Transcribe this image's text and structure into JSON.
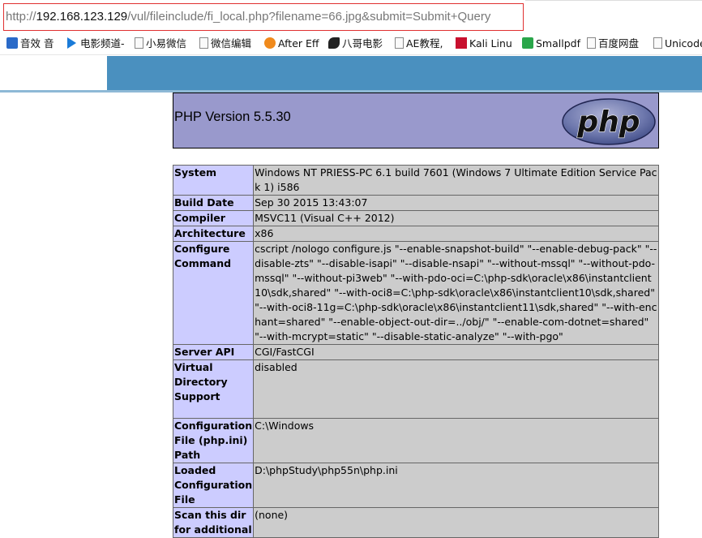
{
  "browser": {
    "url_prefix": "http://",
    "url_host": "192.168.123.129",
    "url_path": "/vul/fileinclude/fi_local.php?filename=66.jpg&submit=Submit+Query"
  },
  "bookmarks": [
    {
      "label": "音效 音",
      "icon": "music-icon"
    },
    {
      "label": "电影频道-",
      "icon": "play-icon"
    },
    {
      "label": "小易微信",
      "icon": "doc-icon"
    },
    {
      "label": "微信编辑",
      "icon": "doc-icon"
    },
    {
      "label": "After Eff",
      "icon": "orange-icon"
    },
    {
      "label": "八哥电影",
      "icon": "bird-icon"
    },
    {
      "label": "AE教程,",
      "icon": "doc-icon"
    },
    {
      "label": "Kali Linu",
      "icon": "kali-icon"
    },
    {
      "label": "Smallpdf",
      "icon": "smallpdf-icon"
    },
    {
      "label": "百度网盘",
      "icon": "doc-icon"
    },
    {
      "label": "Unicode",
      "icon": "doc-icon"
    }
  ],
  "phpinfo": {
    "version": "PHP Version 5.5.30",
    "logo_text": "php",
    "rows": [
      {
        "key": "System",
        "value": "Windows NT PRIESS-PC 6.1 build 7601 (Windows 7 Ultimate Edition Service Pack 1) i586"
      },
      {
        "key": "Build Date",
        "value": "Sep 30 2015 13:43:07"
      },
      {
        "key": "Compiler",
        "value": "MSVC11 (Visual C++ 2012)"
      },
      {
        "key": "Architecture",
        "value": "x86"
      },
      {
        "key": "Configure Command",
        "value": "cscript /nologo configure.js \"--enable-snapshot-build\" \"--enable-debug-pack\" \"--disable-zts\" \"--disable-isapi\" \"--disable-nsapi\" \"--without-mssql\" \"--without-pdo-mssql\" \"--without-pi3web\" \"--with-pdo-oci=C:\\php-sdk\\oracle\\x86\\instantclient10\\sdk,shared\" \"--with-oci8=C:\\php-sdk\\oracle\\x86\\instantclient10\\sdk,shared\" \"--with-oci8-11g=C:\\php-sdk\\oracle\\x86\\instantclient11\\sdk,shared\" \"--with-enchant=shared\" \"--enable-object-out-dir=../obj/\" \"--enable-com-dotnet=shared\" \"--with-mcrypt=static\" \"--disable-static-analyze\" \"--with-pgo\""
      },
      {
        "key": "Server API",
        "value": "CGI/FastCGI"
      },
      {
        "key": "Virtual Directory Support",
        "value": "disabled"
      },
      {
        "key": "Configuration File (php.ini) Path",
        "value": "C:\\Windows"
      },
      {
        "key": "Loaded Configuration File",
        "value": "D:\\phpStudy\\php55n\\php.ini"
      },
      {
        "key": "Scan this dir for additional",
        "value": "(none)"
      }
    ]
  },
  "colors": {
    "header_bg": "#9999cc",
    "key_bg": "#ccccff",
    "value_bg": "#cccccc",
    "band": "#4a90bf",
    "url_border": "#e03030"
  }
}
